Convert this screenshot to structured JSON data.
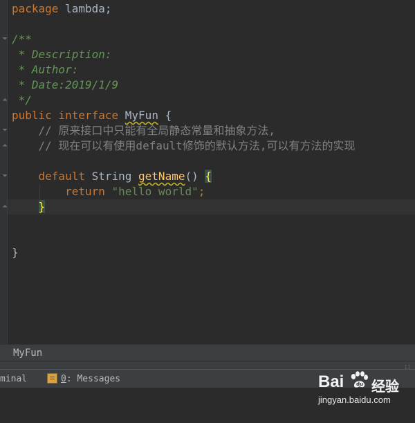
{
  "editor": {
    "lines": {
      "l1": {
        "kw": "package",
        "rest": " lambda;"
      },
      "l3": {
        "doc": "/**"
      },
      "l4": {
        "doc": " * Description:"
      },
      "l5": {
        "doc": " * Author:"
      },
      "l6": {
        "doc": " * Date:2019/1/9"
      },
      "l7": {
        "doc": " */"
      },
      "l8": {
        "kw1": "public",
        "kw2": "interface",
        "name": "MyFun",
        "rest": " {"
      },
      "l9": {
        "cmt": "    // 原来接口中只能有全局静态常量和抽象方法,"
      },
      "l10": {
        "cmt": "    // 现在可以有使用default修饰的默认方法,可以有方法的实现"
      },
      "l12": {
        "kw": "default",
        "type": " String ",
        "method": "getName",
        "rest": "() ",
        "brace": "{"
      },
      "l13": {
        "kw": "return",
        "str": "\"hello world\"",
        "semi": ";"
      },
      "l14": {
        "brace": "}"
      },
      "l17": {
        "brace": "}"
      }
    }
  },
  "breadcrumb": {
    "label": "MyFun"
  },
  "toolwindows": {
    "terminal_label": "minal",
    "messages_num": "0",
    "messages_label": ": Messages"
  },
  "watermark": {
    "brand": "Bai",
    "brand_suffix": "",
    "product": "经验",
    "url": "jingyan.baidu.com"
  }
}
